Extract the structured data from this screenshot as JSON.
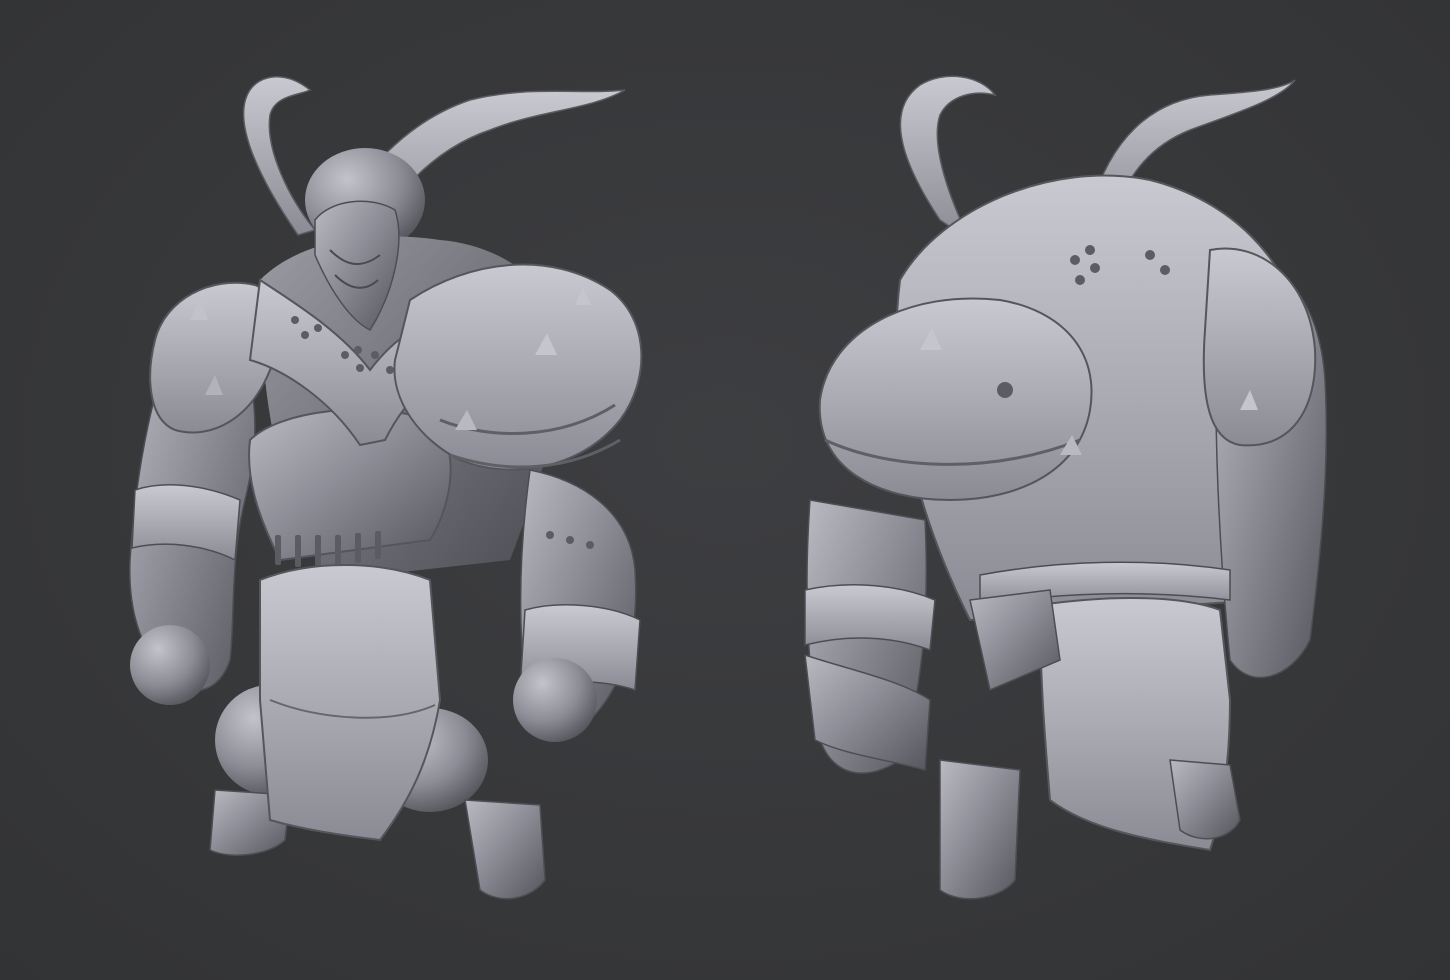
{
  "scene": {
    "background_color": "#38393b",
    "material_color": "#8e8f98",
    "highlight_color": "#c4c5cc",
    "shadow_color": "#44454b"
  },
  "figures": [
    {
      "view": "front-three-quarter",
      "subject": "armored-horned-knight-sculpt"
    },
    {
      "view": "back-three-quarter",
      "subject": "armored-horned-knight-sculpt"
    }
  ]
}
